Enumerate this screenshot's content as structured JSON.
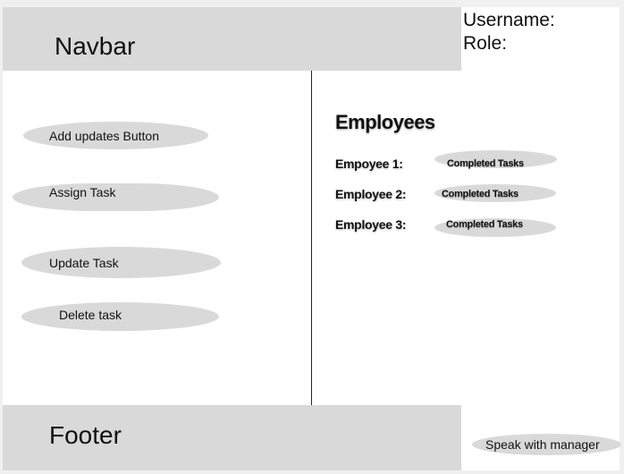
{
  "navbar": {
    "label": "Navbar"
  },
  "user_info": {
    "username_label": "Username:",
    "role_label": "Role:"
  },
  "actions": {
    "add_updates": "Add updates Button",
    "assign_task": "Assign Task",
    "update_task": "Update Task",
    "delete_task": "Delete task"
  },
  "employees": {
    "title": "Employees",
    "rows": [
      {
        "name": "Empoyee 1:",
        "status": "Completed Tasks"
      },
      {
        "name": "Employee 2:",
        "status": "Completed Tasks"
      },
      {
        "name": "Employee 3:",
        "status": "Completed Tasks"
      }
    ]
  },
  "footer": {
    "label": "Footer",
    "contact_button": "Speak with manager"
  }
}
